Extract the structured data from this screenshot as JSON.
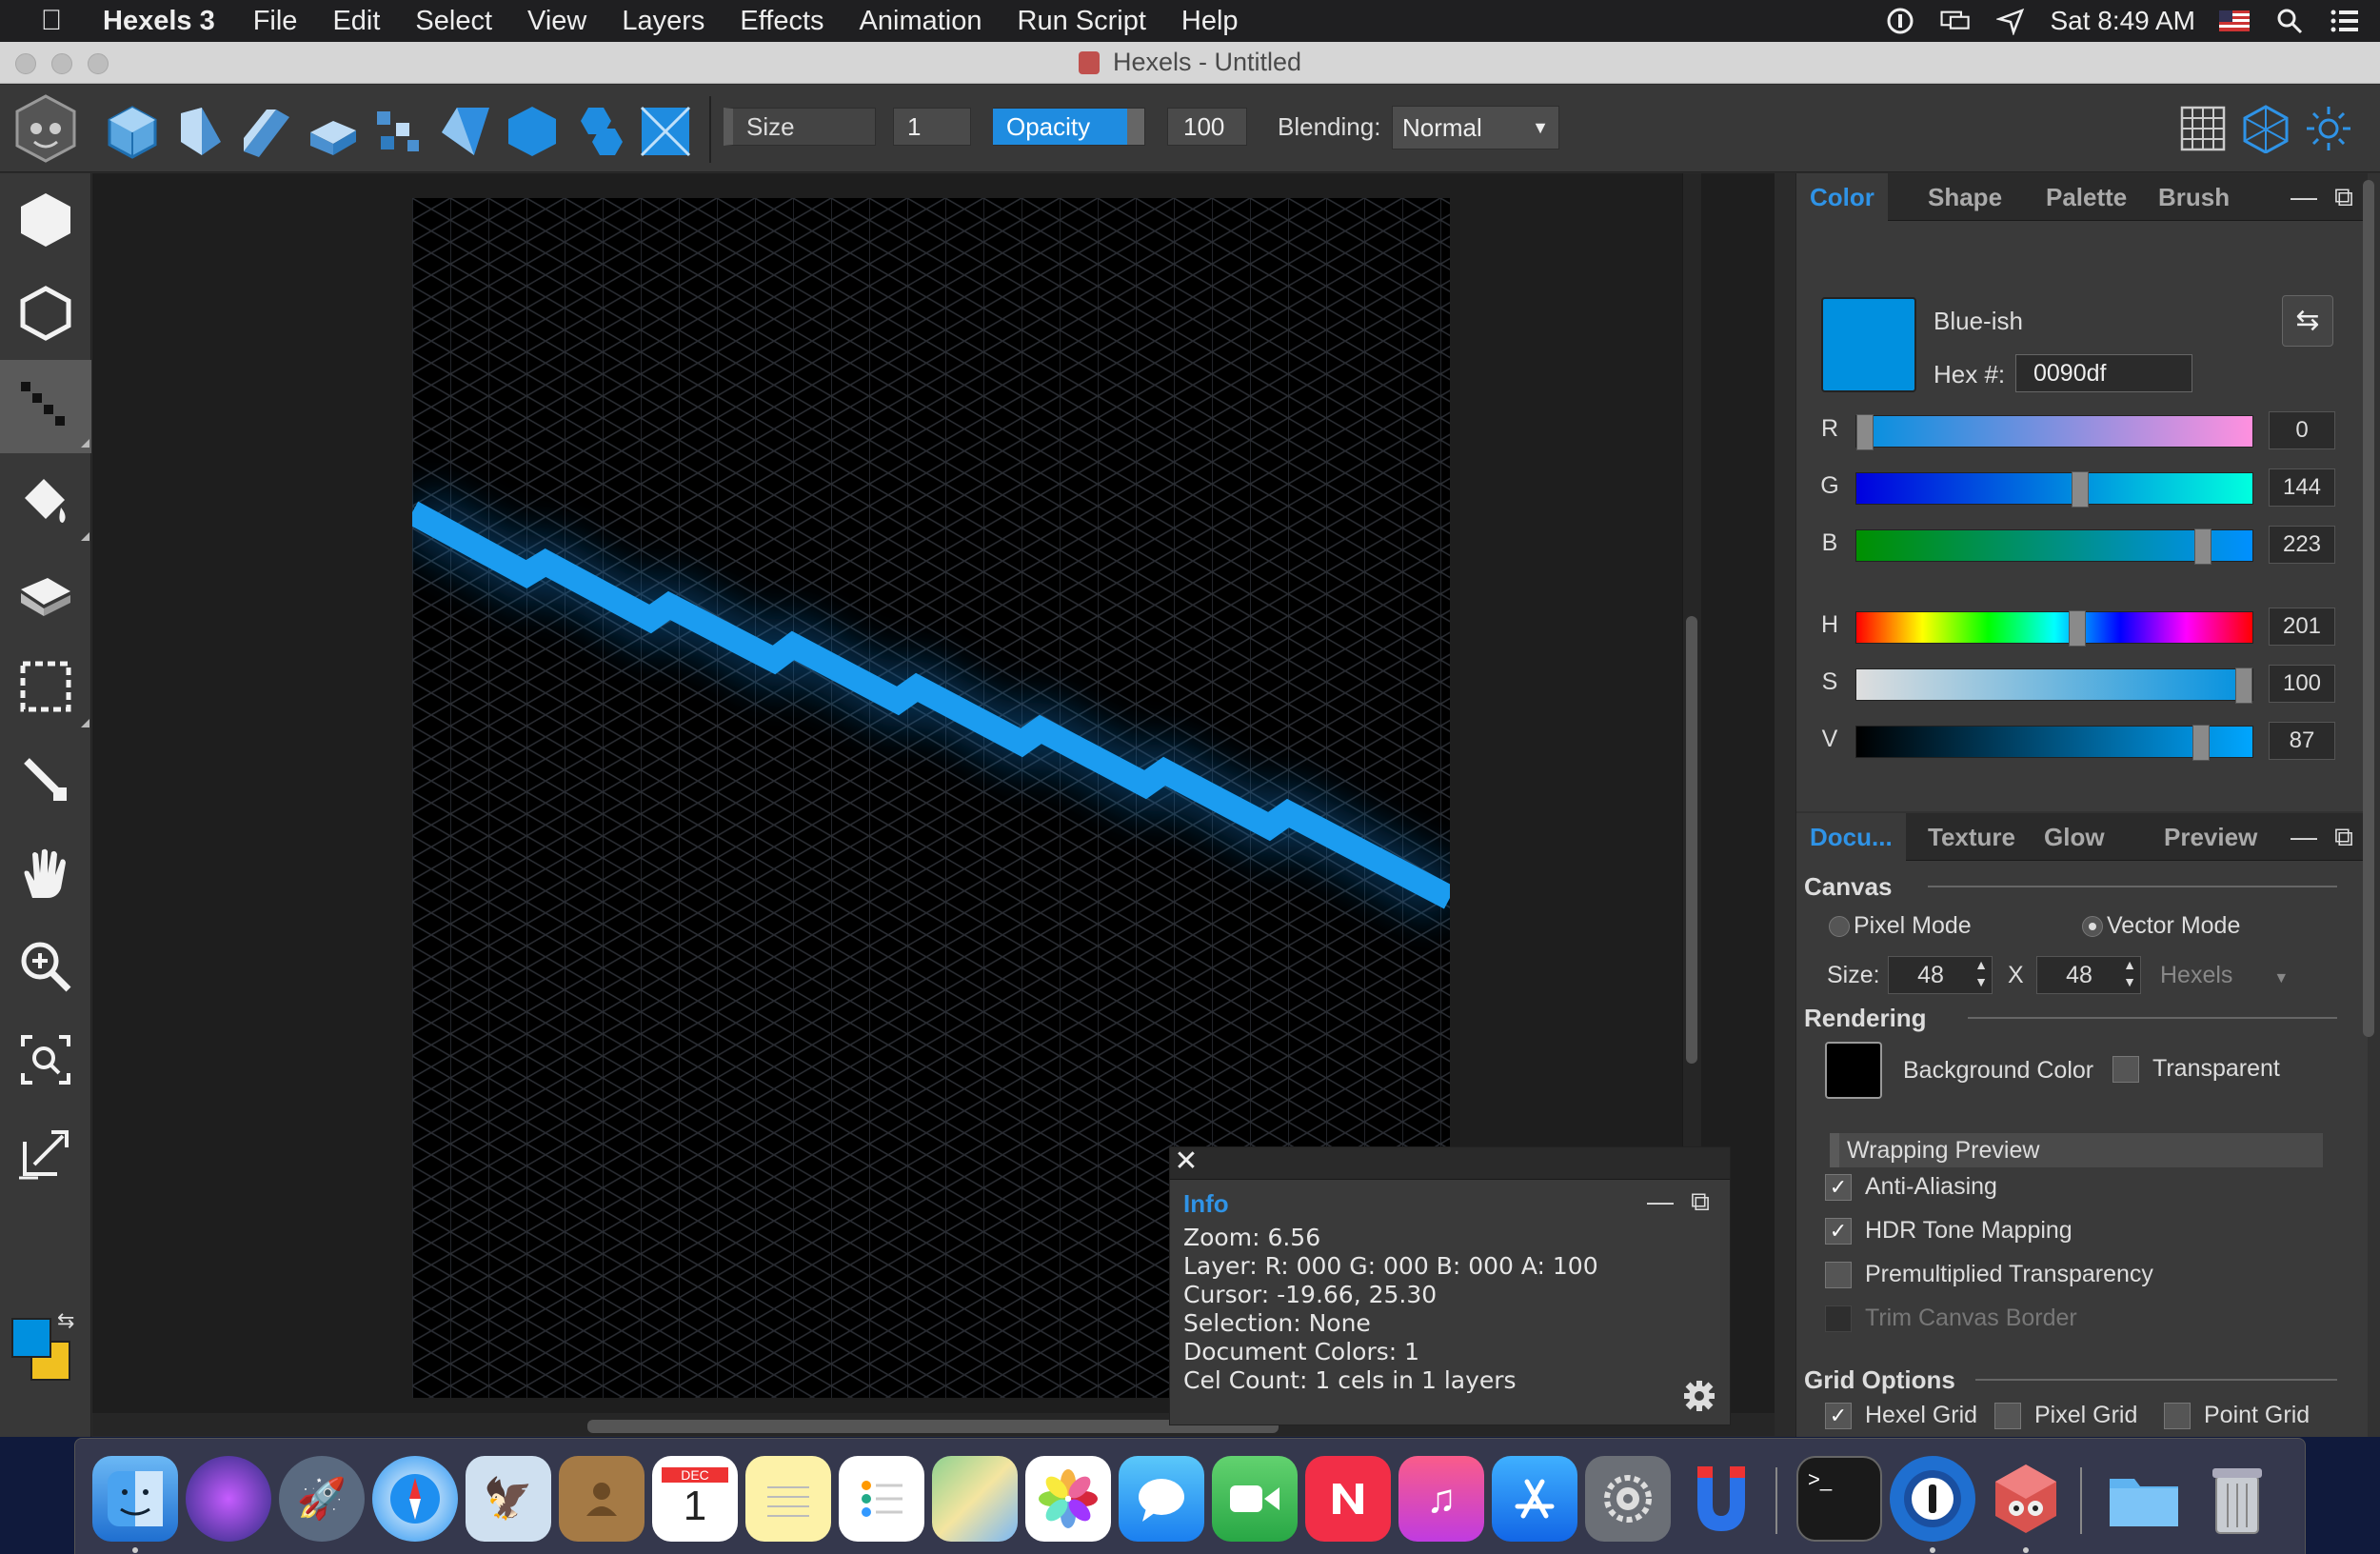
{
  "menubar": {
    "app_name": "Hexels 3",
    "items": [
      "File",
      "Edit",
      "Select",
      "View",
      "Layers",
      "Effects",
      "Animation",
      "Run Script",
      "Help"
    ],
    "clock": "Sat 8:49 AM"
  },
  "window": {
    "title": "Hexels - Untitled"
  },
  "toolbar": {
    "size_label": "Size",
    "size_value": "1",
    "opacity_label": "Opacity",
    "opacity_value": "100",
    "blending_label": "Blending:",
    "blending_value": "Normal"
  },
  "tools": {
    "foreground_color": "#0090df",
    "background_color": "#f0c020"
  },
  "color_palette": {
    "tabs": [
      "Color",
      "Shape",
      "Palette",
      "Brush"
    ],
    "active_tab": "Color",
    "color_name": "Blue-ish",
    "hex_label": "Hex #:",
    "hex_value": "0090df",
    "swatch_color": "#0090df",
    "sliders": [
      {
        "label": "R",
        "value": "0",
        "fraction": 0.0
      },
      {
        "label": "G",
        "value": "144",
        "fraction": 0.565
      },
      {
        "label": "B",
        "value": "223",
        "fraction": 0.875
      },
      {
        "label": "H",
        "value": "201",
        "fraction": 0.558
      },
      {
        "label": "S",
        "value": "100",
        "fraction": 1.0
      },
      {
        "label": "V",
        "value": "87",
        "fraction": 0.87
      }
    ]
  },
  "doc_palette": {
    "tabs": [
      "Docu...",
      "Texture",
      "Glow",
      "Preview"
    ],
    "canvas_title": "Canvas",
    "pixel_mode": "Pixel Mode",
    "vector_mode": "Vector Mode",
    "size_label": "Size:",
    "size_w": "48",
    "size_x": "X",
    "size_h": "48",
    "unit": "Hexels",
    "rendering_title": "Rendering",
    "background_color_label": "Background Color",
    "transparent_label": "Transparent",
    "wrapping_preview": "Wrapping Preview",
    "anti_aliasing": "Anti-Aliasing",
    "hdr_tone_mapping": "HDR Tone Mapping",
    "premultiplied": "Premultiplied Transparency",
    "trim_border": "Trim Canvas Border",
    "grid_title": "Grid Options",
    "hexel_grid": "Hexel Grid",
    "pixel_grid": "Pixel Grid",
    "point_grid": "Point Grid"
  },
  "info_panel": {
    "title": "Info",
    "zoom": "Zoom:  6.56",
    "layer": "Layer:  R:  000  G:  000   B:  000   A:  100",
    "cursor": "Cursor:  -19.66, 25.30",
    "selection": "Selection:  None",
    "doc_colors": "Document Colors:  1",
    "cel_count": "Cel Count:  1 cels in 1 layers"
  },
  "accent_color": "#2f93e6",
  "stroke_color": "#1b9cf0"
}
